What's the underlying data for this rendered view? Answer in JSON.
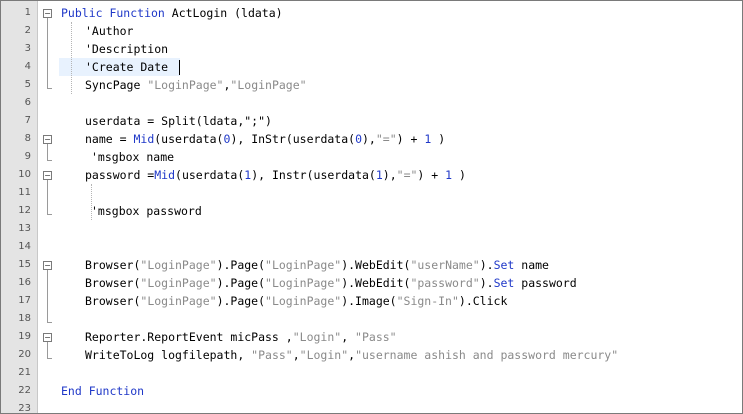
{
  "editor": {
    "lines": [
      {
        "no": "1",
        "code": [
          {
            "t": "Public Function",
            "c": "kw"
          },
          {
            "t": " ActLogin (ldata)"
          }
        ]
      },
      {
        "no": "2",
        "code": [
          {
            "t": "'Author"
          }
        ]
      },
      {
        "no": "3",
        "code": [
          {
            "t": "'Description"
          }
        ]
      },
      {
        "no": "4",
        "code": [
          {
            "t": "'Create Date"
          }
        ]
      },
      {
        "no": "5",
        "code": [
          {
            "t": "SyncPage "
          },
          {
            "t": "\"LoginPage\"",
            "c": "str"
          },
          {
            "t": ","
          },
          {
            "t": "\"LoginPage\"",
            "c": "str"
          }
        ]
      },
      {
        "no": "6",
        "code": []
      },
      {
        "no": "7",
        "code": [
          {
            "t": "userdata = Split(ldata,\";\")"
          }
        ]
      },
      {
        "no": "8",
        "code": [
          {
            "t": "name = "
          },
          {
            "t": "Mid",
            "c": "kw"
          },
          {
            "t": "(userdata("
          },
          {
            "t": "0",
            "c": "num"
          },
          {
            "t": "), InStr(userdata("
          },
          {
            "t": "0",
            "c": "num"
          },
          {
            "t": "),"
          },
          {
            "t": "\"=\"",
            "c": "str"
          },
          {
            "t": ") + "
          },
          {
            "t": "1",
            "c": "num"
          },
          {
            "t": " )"
          }
        ]
      },
      {
        "no": "9",
        "code": [
          {
            "t": "'msgbox name"
          }
        ]
      },
      {
        "no": "10",
        "code": [
          {
            "t": "password ="
          },
          {
            "t": "Mid",
            "c": "kw"
          },
          {
            "t": "(userdata("
          },
          {
            "t": "1",
            "c": "num"
          },
          {
            "t": "), Instr(userdata("
          },
          {
            "t": "1",
            "c": "num"
          },
          {
            "t": "),"
          },
          {
            "t": "\"=\"",
            "c": "str"
          },
          {
            "t": ") + "
          },
          {
            "t": "1",
            "c": "num"
          },
          {
            "t": " )"
          }
        ]
      },
      {
        "no": "11",
        "code": []
      },
      {
        "no": "12",
        "code": [
          {
            "t": "'msgbox password"
          }
        ]
      },
      {
        "no": "13",
        "code": []
      },
      {
        "no": "14",
        "code": []
      },
      {
        "no": "15",
        "code": [
          {
            "t": "Browser("
          },
          {
            "t": "\"LoginPage\"",
            "c": "str"
          },
          {
            "t": ").Page("
          },
          {
            "t": "\"LoginPage\"",
            "c": "str"
          },
          {
            "t": ").WebEdit("
          },
          {
            "t": "\"userName\"",
            "c": "str"
          },
          {
            "t": ")."
          },
          {
            "t": "Set",
            "c": "kw"
          },
          {
            "t": " name"
          }
        ]
      },
      {
        "no": "16",
        "code": [
          {
            "t": "Browser("
          },
          {
            "t": "\"LoginPage\"",
            "c": "str"
          },
          {
            "t": ").Page("
          },
          {
            "t": "\"LoginPage\"",
            "c": "str"
          },
          {
            "t": ").WebEdit("
          },
          {
            "t": "\"password\"",
            "c": "str"
          },
          {
            "t": ")."
          },
          {
            "t": "Set",
            "c": "kw"
          },
          {
            "t": " password"
          }
        ]
      },
      {
        "no": "17",
        "code": [
          {
            "t": "Browser("
          },
          {
            "t": "\"LoginPage\"",
            "c": "str"
          },
          {
            "t": ").Page("
          },
          {
            "t": "\"LoginPage\"",
            "c": "str"
          },
          {
            "t": ").Image("
          },
          {
            "t": "\"Sign-In\"",
            "c": "str"
          },
          {
            "t": ").Click"
          }
        ]
      },
      {
        "no": "18",
        "code": []
      },
      {
        "no": "19",
        "code": [
          {
            "t": "Reporter.ReportEvent micPass ,"
          },
          {
            "t": "\"Login\"",
            "c": "str"
          },
          {
            "t": ", "
          },
          {
            "t": "\"Pass\"",
            "c": "str"
          }
        ]
      },
      {
        "no": "20",
        "code": [
          {
            "t": "WriteToLog logfilepath, "
          },
          {
            "t": "\"Pass\"",
            "c": "str"
          },
          {
            "t": ","
          },
          {
            "t": "\"Login\"",
            "c": "str"
          },
          {
            "t": ","
          },
          {
            "t": "\"username ashish and password mercury\"",
            "c": "str"
          }
        ]
      },
      {
        "no": "21",
        "code": []
      },
      {
        "no": "22",
        "code": [
          {
            "t": "End Function",
            "c": "kw"
          }
        ]
      },
      {
        "no": "23",
        "code": []
      }
    ],
    "icons": {
      "fold_open": "minus-box-icon"
    },
    "colors": {
      "keyword": "#1f38c8",
      "string": "#8a8a8a",
      "gutter": "#e4e4e4",
      "current_line": "#e8f2fe"
    }
  }
}
